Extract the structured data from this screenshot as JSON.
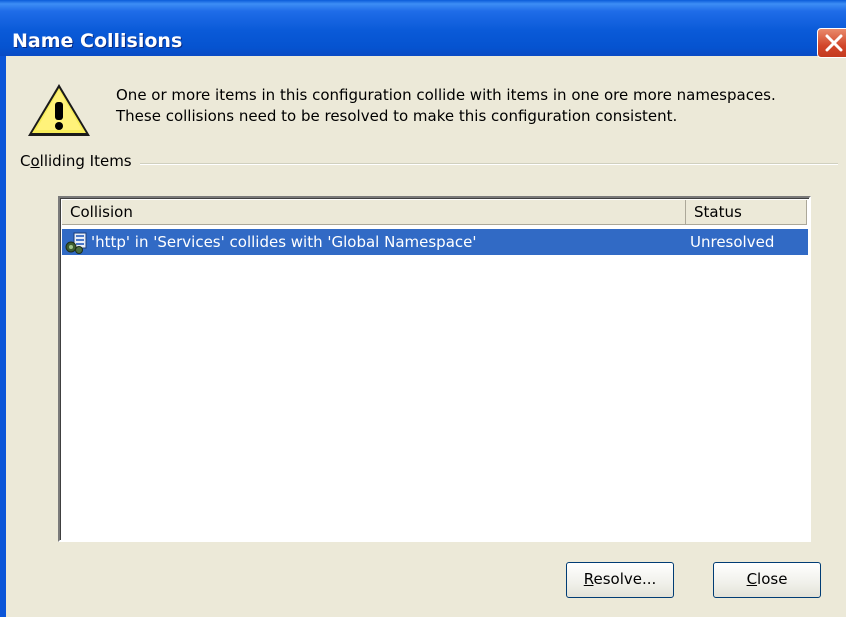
{
  "window": {
    "title": "Name Collisions"
  },
  "message": {
    "line1": "One or more items in this configuration collide with items in one ore more namespaces.",
    "line2": "These collisions need to be resolved to make this configuration consistent."
  },
  "group": {
    "label_prefix": "C",
    "label_mnemonic": "o",
    "label_rest": "lliding Items"
  },
  "list": {
    "columns": [
      "Collision",
      "Status"
    ],
    "rows": [
      {
        "collision": "'http' in 'Services' collides with 'Global Namespace'",
        "status": "Unresolved",
        "selected": true,
        "icon": "service-collision-icon"
      }
    ]
  },
  "buttons": {
    "resolve": {
      "mnemonic": "R",
      "rest": "esolve..."
    },
    "close": {
      "mnemonic": "C",
      "rest": "lose"
    }
  },
  "colors": {
    "titlebar": "#0a5ad8",
    "selection": "#316ac5",
    "dialog_bg": "#ece9d8"
  }
}
